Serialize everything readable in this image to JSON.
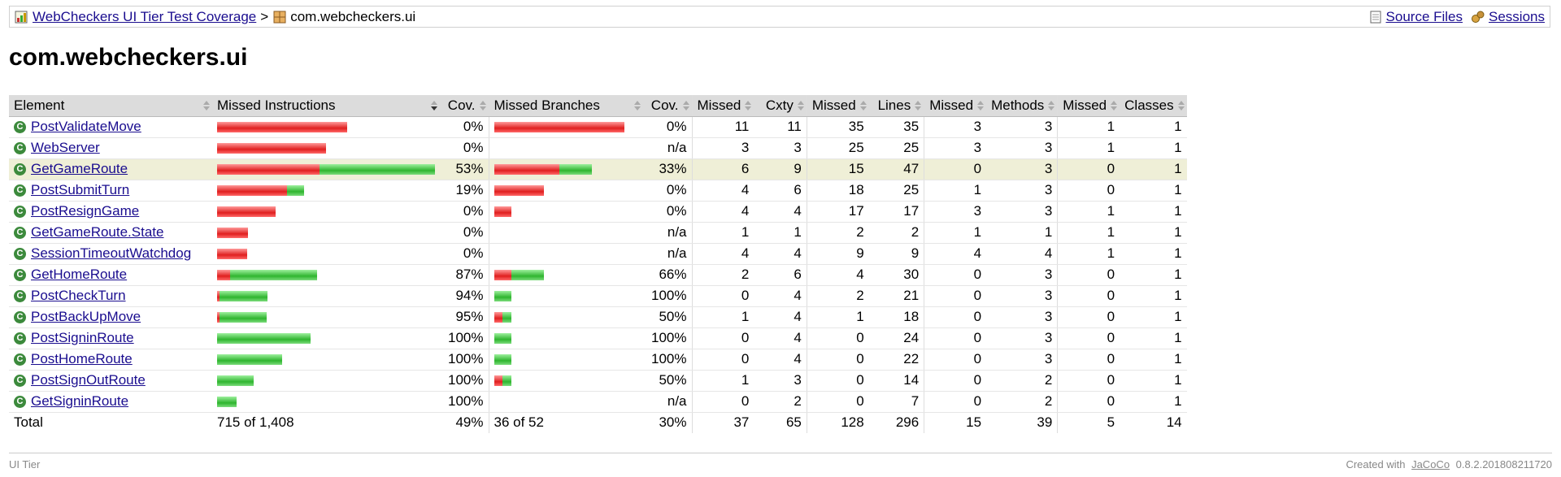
{
  "breadcrumb": {
    "report_link": "WebCheckers UI Tier Test Coverage",
    "separator": ">",
    "package": "com.webcheckers.ui",
    "source_files": "Source Files",
    "sessions": "Sessions",
    "icons": {
      "report": "report-icon",
      "package": "package-icon",
      "source": "source-files-icon",
      "sessions": "sessions-icon"
    }
  },
  "page_title": "com.webcheckers.ui",
  "table": {
    "headers": [
      "Element",
      "Missed Instructions",
      "Cov.",
      "Missed Branches",
      "Cov.",
      "Missed",
      "Cxty",
      "Missed",
      "Lines",
      "Missed",
      "Methods",
      "Missed",
      "Classes"
    ],
    "rows": [
      {
        "name": "PostValidateMove",
        "instr_missed": 1.0,
        "instr_total": 1.0,
        "instr_cov": "0%",
        "br_missed": 1.0,
        "br_total": 1.0,
        "br_cov": "0%",
        "cxty_missed": "11",
        "cxty": "11",
        "lines_missed": "35",
        "lines": "35",
        "methods_missed": "3",
        "methods": "3",
        "classes_missed": "1",
        "classes": "1"
      },
      {
        "name": "WebServer",
        "instr_missed": 0.84,
        "instr_total": 0.84,
        "instr_cov": "0%",
        "br_missed": 0,
        "br_total": 0,
        "br_cov": "n/a",
        "cxty_missed": "3",
        "cxty": "3",
        "lines_missed": "25",
        "lines": "25",
        "methods_missed": "3",
        "methods": "3",
        "classes_missed": "1",
        "classes": "1"
      },
      {
        "name": "GetGameRoute",
        "instr_missed": 0.79,
        "instr_total": 1.68,
        "instr_cov": "53%",
        "br_missed": 0.5,
        "br_total": 0.75,
        "br_cov": "33%",
        "cxty_missed": "6",
        "cxty": "9",
        "lines_missed": "15",
        "lines": "47",
        "methods_missed": "0",
        "methods": "3",
        "classes_missed": "0",
        "classes": "1",
        "highlight": true
      },
      {
        "name": "PostSubmitTurn",
        "instr_missed": 0.54,
        "instr_total": 0.67,
        "instr_cov": "19%",
        "br_missed": 0.38,
        "br_total": 0.38,
        "br_cov": "0%",
        "cxty_missed": "4",
        "cxty": "6",
        "lines_missed": "18",
        "lines": "25",
        "methods_missed": "1",
        "methods": "3",
        "classes_missed": "0",
        "classes": "1"
      },
      {
        "name": "PostResignGame",
        "instr_missed": 0.45,
        "instr_total": 0.45,
        "instr_cov": "0%",
        "br_missed": 0.13,
        "br_total": 0.13,
        "br_cov": "0%",
        "cxty_missed": "4",
        "cxty": "4",
        "lines_missed": "17",
        "lines": "17",
        "methods_missed": "3",
        "methods": "3",
        "classes_missed": "1",
        "classes": "1"
      },
      {
        "name": "GetGameRoute.State",
        "instr_missed": 0.24,
        "instr_total": 0.24,
        "instr_cov": "0%",
        "br_missed": 0,
        "br_total": 0,
        "br_cov": "n/a",
        "cxty_missed": "1",
        "cxty": "1",
        "lines_missed": "2",
        "lines": "2",
        "methods_missed": "1",
        "methods": "1",
        "classes_missed": "1",
        "classes": "1"
      },
      {
        "name": "SessionTimeoutWatchdog",
        "instr_missed": 0.23,
        "instr_total": 0.23,
        "instr_cov": "0%",
        "br_missed": 0,
        "br_total": 0,
        "br_cov": "n/a",
        "cxty_missed": "4",
        "cxty": "4",
        "lines_missed": "9",
        "lines": "9",
        "methods_missed": "4",
        "methods": "4",
        "classes_missed": "1",
        "classes": "1"
      },
      {
        "name": "GetHomeRoute",
        "instr_missed": 0.1,
        "instr_total": 0.77,
        "instr_cov": "87%",
        "br_missed": 0.13,
        "br_total": 0.38,
        "br_cov": "66%",
        "cxty_missed": "2",
        "cxty": "6",
        "lines_missed": "4",
        "lines": "30",
        "methods_missed": "0",
        "methods": "3",
        "classes_missed": "0",
        "classes": "1"
      },
      {
        "name": "PostCheckTurn",
        "instr_missed": 0.02,
        "instr_total": 0.39,
        "instr_cov": "94%",
        "br_missed": 0,
        "br_total": 0.13,
        "br_cov": "100%",
        "cxty_missed": "0",
        "cxty": "4",
        "lines_missed": "2",
        "lines": "21",
        "methods_missed": "0",
        "methods": "3",
        "classes_missed": "0",
        "classes": "1"
      },
      {
        "name": "PostBackUpMove",
        "instr_missed": 0.02,
        "instr_total": 0.38,
        "instr_cov": "95%",
        "br_missed": 0.06,
        "br_total": 0.13,
        "br_cov": "50%",
        "cxty_missed": "1",
        "cxty": "4",
        "lines_missed": "1",
        "lines": "18",
        "methods_missed": "0",
        "methods": "3",
        "classes_missed": "0",
        "classes": "1"
      },
      {
        "name": "PostSigninRoute",
        "instr_missed": 0,
        "instr_total": 0.72,
        "instr_cov": "100%",
        "br_missed": 0,
        "br_total": 0.13,
        "br_cov": "100%",
        "cxty_missed": "0",
        "cxty": "4",
        "lines_missed": "0",
        "lines": "24",
        "methods_missed": "0",
        "methods": "3",
        "classes_missed": "0",
        "classes": "1"
      },
      {
        "name": "PostHomeRoute",
        "instr_missed": 0,
        "instr_total": 0.5,
        "instr_cov": "100%",
        "br_missed": 0,
        "br_total": 0.13,
        "br_cov": "100%",
        "cxty_missed": "0",
        "cxty": "4",
        "lines_missed": "0",
        "lines": "22",
        "methods_missed": "0",
        "methods": "3",
        "classes_missed": "0",
        "classes": "1"
      },
      {
        "name": "PostSignOutRoute",
        "instr_missed": 0,
        "instr_total": 0.28,
        "instr_cov": "100%",
        "br_missed": 0.06,
        "br_total": 0.13,
        "br_cov": "50%",
        "cxty_missed": "1",
        "cxty": "3",
        "lines_missed": "0",
        "lines": "14",
        "methods_missed": "0",
        "methods": "2",
        "classes_missed": "0",
        "classes": "1"
      },
      {
        "name": "GetSigninRoute",
        "instr_missed": 0,
        "instr_total": 0.15,
        "instr_cov": "100%",
        "br_missed": 0,
        "br_total": 0,
        "br_cov": "n/a",
        "cxty_missed": "0",
        "cxty": "2",
        "lines_missed": "0",
        "lines": "7",
        "methods_missed": "0",
        "methods": "2",
        "classes_missed": "0",
        "classes": "1"
      }
    ],
    "total": {
      "label": "Total",
      "instr": "715 of 1,408",
      "instr_cov": "49%",
      "br": "36 of 52",
      "br_cov": "30%",
      "cxty_missed": "37",
      "cxty": "65",
      "lines_missed": "128",
      "lines": "296",
      "methods_missed": "15",
      "methods": "39",
      "classes_missed": "5",
      "classes": "14"
    }
  },
  "footer": {
    "left": "UI Tier",
    "created_with": "Created with",
    "jacoco": "JaCoCo",
    "version": "0.8.2.201808211720"
  },
  "colors": {
    "missed": "#e01f1f",
    "covered": "#2fb52f",
    "highlight": "#efefd7"
  }
}
